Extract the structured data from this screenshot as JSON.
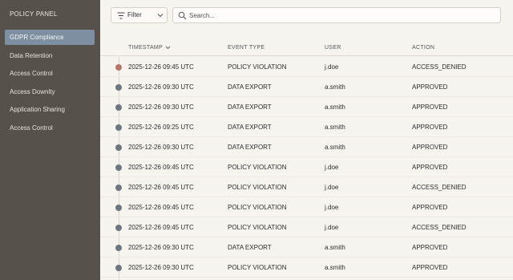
{
  "sidebar": {
    "title": "POLICY PANEL",
    "items": [
      {
        "label": "GDPR Compliance",
        "active": true
      },
      {
        "label": "Data Retention",
        "active": false
      },
      {
        "label": "Access Control",
        "active": false
      },
      {
        "label": "Access Downlty",
        "active": false
      },
      {
        "label": "Application Sharing",
        "active": false
      },
      {
        "label": "Access Control",
        "active": false
      }
    ]
  },
  "toolbar": {
    "filter_label": "Filter",
    "search_placeholder": "Search..."
  },
  "table": {
    "columns": [
      "TIMESTAMP",
      "EVENT TYPE",
      "USER",
      "ACTION"
    ],
    "rows": [
      {
        "timestamp": "2025-12-26 09:45 UTC",
        "event": "POLICY VIOLATION",
        "user": "j.doe",
        "action": "ACCESS_DENIED",
        "marker": "violation"
      },
      {
        "timestamp": "2025-12-26 09:30 UTC",
        "event": "DATA EXPORT",
        "user": "a.smith",
        "action": "APPROVED",
        "marker": "normal"
      },
      {
        "timestamp": "2025-12-26 09:30 UTC",
        "event": "DATA EXPORT",
        "user": "a.smith",
        "action": "APPROVED",
        "marker": "normal"
      },
      {
        "timestamp": "2025-12-26 09:25 UTC",
        "event": "DATA EXPORT",
        "user": "a.smith",
        "action": "APPROVED",
        "marker": "normal"
      },
      {
        "timestamp": "2025-12-26 09:30 UTC",
        "event": "DATA EXPORT",
        "user": "a.smith",
        "action": "APPROVED",
        "marker": "normal"
      },
      {
        "timestamp": "2025-12-26 09:45 UTC",
        "event": "POLICY VIOLATION",
        "user": "j.doe",
        "action": "APPROVED",
        "marker": "normal"
      },
      {
        "timestamp": "2025-12-26 09:45 UTC",
        "event": "POLICY VIOLATION",
        "user": "j.doe",
        "action": "ACCESS_DENIED",
        "marker": "normal"
      },
      {
        "timestamp": "2025-12-26 09:45 UTC",
        "event": "POLICY VIOLATION",
        "user": "j.doe",
        "action": "APPROVED",
        "marker": "normal"
      },
      {
        "timestamp": "2025-12-26 09:45 UTC",
        "event": "POLICY VIOLATION",
        "user": "j.doe",
        "action": "ACCESS_DENIED",
        "marker": "normal"
      },
      {
        "timestamp": "2025-12-26 09:30 UTC",
        "event": "DATA EXPORT",
        "user": "a.smith",
        "action": "APPROVED",
        "marker": "normal"
      },
      {
        "timestamp": "2025-12-26 09:30 UTC",
        "event": "POLICY VIOLATION",
        "user": "a.smith",
        "action": "APPROVED",
        "marker": "normal"
      }
    ]
  },
  "icons": {
    "filter": "filter-icon",
    "chevron": "chevron-down-icon",
    "search": "search-icon",
    "sort": "sort-chevron-icon"
  },
  "colors": {
    "sidebar_bg": "#56524b",
    "sidebar_active": "#7d8fa0",
    "main_bg": "#f6f4ef",
    "dot_normal": "#6e7680",
    "dot_violation": "#b5766c"
  }
}
